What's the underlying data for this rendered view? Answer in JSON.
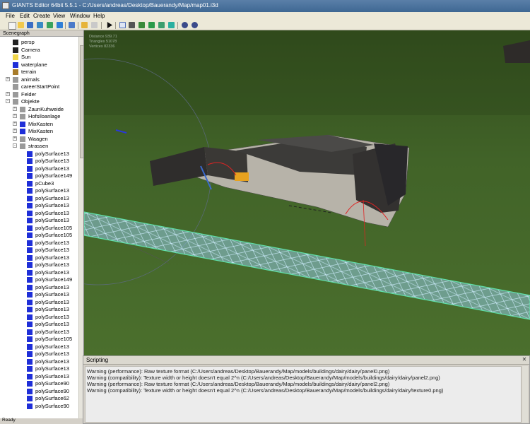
{
  "titlebar": {
    "title": "GIANTS Editor 64bit 5.5.1 - C:/Users/andreas/Desktop/Bauerandy/Map/map01.i3d"
  },
  "menubar": {
    "items": [
      "File",
      "Edit",
      "Create",
      "View",
      "Window",
      "Help"
    ]
  },
  "toolbar": {
    "buttons": [
      "new-icon",
      "open-icon",
      "save-icon",
      "save-as-icon",
      "refresh-icon",
      "export-icon",
      "undo-icon",
      "redo-icon",
      "cut-icon",
      "play-icon",
      "select-icon",
      "move-icon",
      "terrain-paint-icon",
      "foliage-paint-icon",
      "terrain-sculpt-icon",
      "settings-icon",
      "settings-icon-2"
    ]
  },
  "scenegraph": {
    "title": "Scenegraph",
    "rows": [
      {
        "label": "persp",
        "icon": "camera",
        "indent": 0,
        "exp": ""
      },
      {
        "label": "Camera",
        "icon": "camera",
        "indent": 0,
        "exp": ""
      },
      {
        "label": "Sun",
        "icon": "light",
        "indent": 0,
        "exp": ""
      },
      {
        "label": "waterplane",
        "icon": "cube",
        "indent": 0,
        "exp": ""
      },
      {
        "label": "terrain",
        "icon": "terrain",
        "indent": 0,
        "exp": ""
      },
      {
        "label": "animals",
        "icon": "group",
        "indent": 0,
        "exp": "+"
      },
      {
        "label": "careerStartPoint",
        "icon": "group",
        "indent": 0,
        "exp": ""
      },
      {
        "label": "Felder",
        "icon": "group",
        "indent": 0,
        "exp": "+"
      },
      {
        "label": "Objekte",
        "icon": "group",
        "indent": 0,
        "exp": "-"
      },
      {
        "label": "ZaunKuhweide",
        "icon": "group",
        "indent": 1,
        "exp": "+"
      },
      {
        "label": "Hofsiloanlage",
        "icon": "group",
        "indent": 1,
        "exp": "+"
      },
      {
        "label": "MixKasten",
        "icon": "cube",
        "indent": 1,
        "exp": "+"
      },
      {
        "label": "MixKasten",
        "icon": "cube",
        "indent": 1,
        "exp": "+"
      },
      {
        "label": "Waagen",
        "icon": "group",
        "indent": 1,
        "exp": "+"
      },
      {
        "label": "strassen",
        "icon": "group",
        "indent": 1,
        "exp": "-"
      },
      {
        "label": "polySurface13",
        "icon": "cube",
        "indent": 2,
        "exp": ""
      },
      {
        "label": "polySurface13",
        "icon": "cube",
        "indent": 2,
        "exp": ""
      },
      {
        "label": "polySurface13",
        "icon": "cube",
        "indent": 2,
        "exp": ""
      },
      {
        "label": "polySurface149",
        "icon": "cube",
        "indent": 2,
        "exp": ""
      },
      {
        "label": "pCube3",
        "icon": "cube",
        "indent": 2,
        "exp": ""
      },
      {
        "label": "polySurface13",
        "icon": "cube",
        "indent": 2,
        "exp": ""
      },
      {
        "label": "polySurface13",
        "icon": "cube",
        "indent": 2,
        "exp": ""
      },
      {
        "label": "polySurface13",
        "icon": "cube",
        "indent": 2,
        "exp": ""
      },
      {
        "label": "polySurface13",
        "icon": "cube",
        "indent": 2,
        "exp": ""
      },
      {
        "label": "polySurface13",
        "icon": "cube",
        "indent": 2,
        "exp": ""
      },
      {
        "label": "polySurface105",
        "icon": "cube",
        "indent": 2,
        "exp": ""
      },
      {
        "label": "polySurface105",
        "icon": "cube",
        "indent": 2,
        "exp": ""
      },
      {
        "label": "polySurface13",
        "icon": "cube",
        "indent": 2,
        "exp": ""
      },
      {
        "label": "polySurface13",
        "icon": "cube",
        "indent": 2,
        "exp": ""
      },
      {
        "label": "polySurface13",
        "icon": "cube",
        "indent": 2,
        "exp": ""
      },
      {
        "label": "polySurface13",
        "icon": "cube",
        "indent": 2,
        "exp": ""
      },
      {
        "label": "polySurface13",
        "icon": "cube",
        "indent": 2,
        "exp": ""
      },
      {
        "label": "polySurface149",
        "icon": "cube",
        "indent": 2,
        "exp": ""
      },
      {
        "label": "polySurface13",
        "icon": "cube",
        "indent": 2,
        "exp": ""
      },
      {
        "label": "polySurface13",
        "icon": "cube",
        "indent": 2,
        "exp": ""
      },
      {
        "label": "polySurface13",
        "icon": "cube",
        "indent": 2,
        "exp": ""
      },
      {
        "label": "polySurface13",
        "icon": "cube",
        "indent": 2,
        "exp": ""
      },
      {
        "label": "polySurface13",
        "icon": "cube",
        "indent": 2,
        "exp": ""
      },
      {
        "label": "polySurface13",
        "icon": "cube",
        "indent": 2,
        "exp": ""
      },
      {
        "label": "polySurface13",
        "icon": "cube",
        "indent": 2,
        "exp": ""
      },
      {
        "label": "polySurface105",
        "icon": "cube",
        "indent": 2,
        "exp": ""
      },
      {
        "label": "polySurface13",
        "icon": "cube",
        "indent": 2,
        "exp": ""
      },
      {
        "label": "polySurface13",
        "icon": "cube",
        "indent": 2,
        "exp": ""
      },
      {
        "label": "polySurface13",
        "icon": "cube",
        "indent": 2,
        "exp": ""
      },
      {
        "label": "polySurface13",
        "icon": "cube",
        "indent": 2,
        "exp": ""
      },
      {
        "label": "polySurface13",
        "icon": "cube",
        "indent": 2,
        "exp": ""
      },
      {
        "label": "polySurface90",
        "icon": "cube",
        "indent": 2,
        "exp": ""
      },
      {
        "label": "polySurface90",
        "icon": "cube",
        "indent": 2,
        "exp": ""
      },
      {
        "label": "polySurface62",
        "icon": "cube",
        "indent": 2,
        "exp": ""
      },
      {
        "label": "polySurface90",
        "icon": "cube",
        "indent": 2,
        "exp": ""
      }
    ]
  },
  "viewport": {
    "stats": [
      "Distance 939.71",
      "Triangles 51078",
      "Vertices 82336"
    ]
  },
  "scripting": {
    "title": "Scripting",
    "lines": [
      "Warning (performance): Raw texture format (C:/Users/andreas/Desktop/Bauerandy/Map/models/buildings/dairy/dairy/panel0.png)",
      "Warning (compatibility): Texture width or height doesn't equal 2^n (C:/Users/andreas/Desktop/Bauerandy/Map/models/buildings/dairy/dairy/panel2.png)",
      "Warning (performance): Raw texture format (C:/Users/andreas/Desktop/Bauerandy/Map/models/buildings/dairy/dairy/panel2.png)",
      "Warning (compatibility): Texture width or height doesn't equal 2^n (C:/Users/andreas/Desktop/Bauerandy/Map/models/buildings/dairy/dairy/texture0.png)"
    ]
  },
  "statusbar": {
    "text": "Ready"
  },
  "colors": {
    "titlebar": "#4a729d",
    "grass": "#3f6327",
    "road_mesh": "#8ecbe6",
    "icon_blue": "#1f2fd8"
  }
}
